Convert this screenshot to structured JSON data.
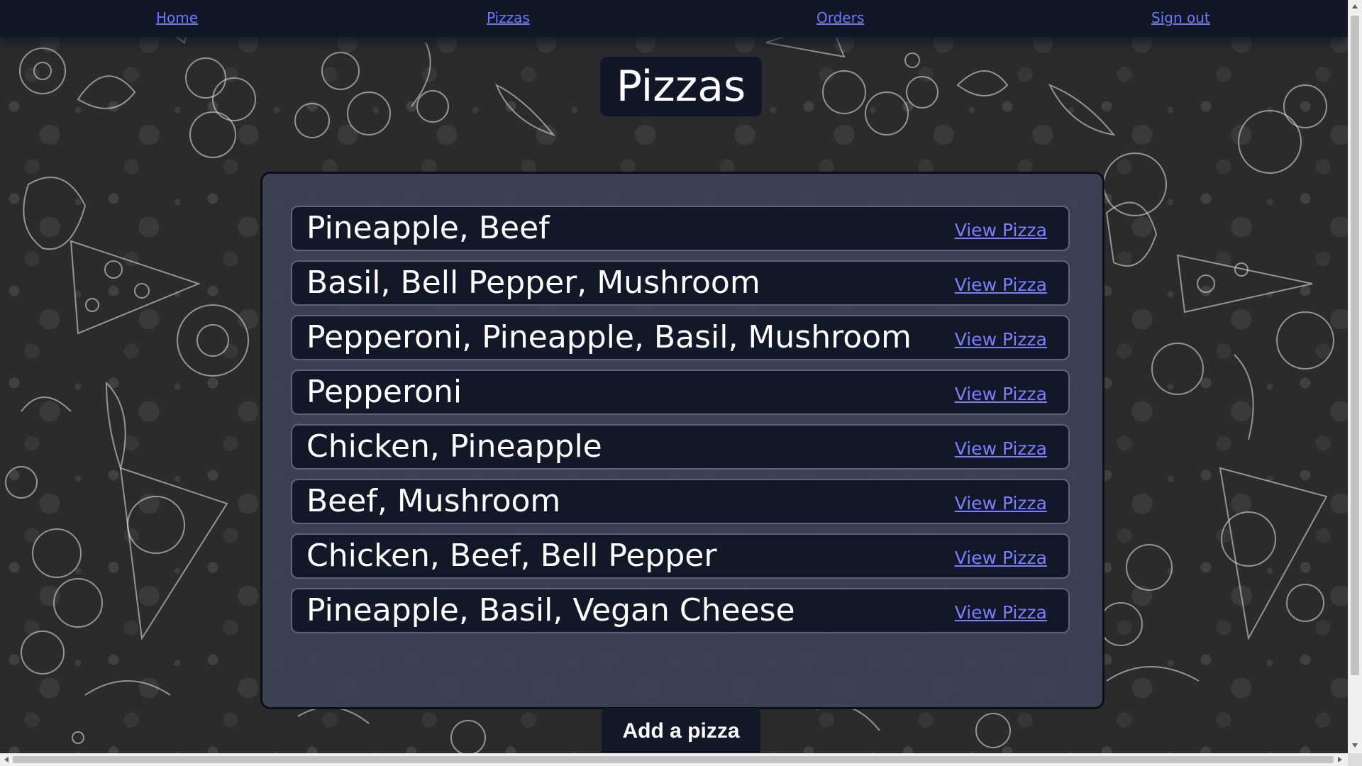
{
  "nav": {
    "home": "Home",
    "pizzas": "Pizzas",
    "orders": "Orders",
    "sign_out": "Sign out"
  },
  "page": {
    "title": "Pizzas"
  },
  "pizzas": [
    {
      "name": "Pineapple, Beef",
      "link": "View Pizza"
    },
    {
      "name": "Basil, Bell Pepper, Mushroom",
      "link": "View Pizza"
    },
    {
      "name": "Pepperoni, Pineapple, Basil, Mushroom",
      "link": "View Pizza"
    },
    {
      "name": "Pepperoni",
      "link": "View Pizza"
    },
    {
      "name": "Chicken, Pineapple",
      "link": "View Pizza"
    },
    {
      "name": "Beef, Mushroom",
      "link": "View Pizza"
    },
    {
      "name": "Chicken, Beef, Bell Pepper",
      "link": "View Pizza"
    },
    {
      "name": "Pineapple, Basil, Vegan Cheese",
      "link": "View Pizza"
    }
  ],
  "actions": {
    "add_pizza": "Add a pizza"
  },
  "colors": {
    "navbar": "#111726",
    "link": "#6f78ff",
    "panel": "#3a4356",
    "row": "#121827"
  }
}
